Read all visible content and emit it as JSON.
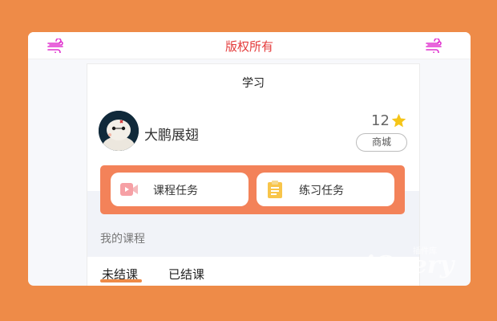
{
  "header": {
    "title": "版权所有",
    "left_icon": "wind-icon",
    "right_icon": "wind-icon",
    "title_color": "#E43B3B"
  },
  "page": {
    "title": "学习"
  },
  "profile": {
    "username": "大鹏展翅",
    "points": "12",
    "mall_button": "商城",
    "avatar_icon": "robot-avatar"
  },
  "tasks": [
    {
      "label": "课程任务",
      "icon": "video-icon"
    },
    {
      "label": "练习任务",
      "icon": "clipboard-icon"
    }
  ],
  "section": {
    "label": "我的课程"
  },
  "tabs": [
    {
      "label": "未结课",
      "active": true
    },
    {
      "label": "已结课",
      "active": false
    }
  ],
  "watermark": {
    "text": "jQuery",
    "sub": "插件库"
  },
  "colors": {
    "background": "#EE8B48",
    "accent": "#F38259",
    "star": "#F5C518"
  }
}
